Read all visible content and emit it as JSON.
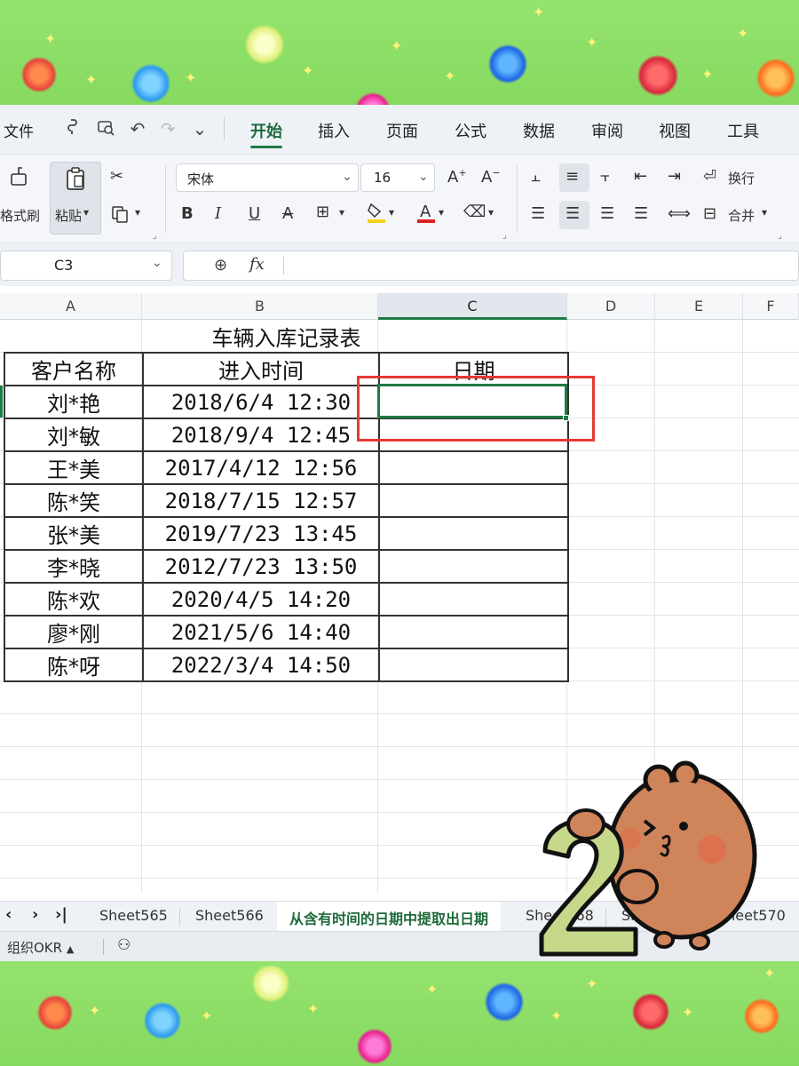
{
  "menubar": {
    "file": "文件",
    "tabs": [
      "开始",
      "插入",
      "页面",
      "公式",
      "数据",
      "审阅",
      "视图",
      "工具"
    ],
    "active_tab": "开始"
  },
  "ribbon": {
    "format_painter": "格式刷",
    "paste": "粘贴",
    "font_name": "宋体",
    "font_size": "16",
    "wrap_text": "换行",
    "merge": "合并"
  },
  "formula_bar": {
    "cell_ref": "C3",
    "fx_label": "fx",
    "content": ""
  },
  "columns": [
    "A",
    "B",
    "C",
    "D",
    "E",
    "F"
  ],
  "table": {
    "title": "车辆入库记录表",
    "headers": [
      "客户名称",
      "进入时间",
      "日期"
    ],
    "rows": [
      {
        "name": "刘*艳",
        "time": "2018/6/4 12:30",
        "date": ""
      },
      {
        "name": "刘*敏",
        "time": "2018/9/4 12:45",
        "date": ""
      },
      {
        "name": "王*美",
        "time": "2017/4/12 12:56",
        "date": ""
      },
      {
        "name": "陈*笑",
        "time": "2018/7/15 12:57",
        "date": ""
      },
      {
        "name": "张*美",
        "time": "2019/7/23 13:45",
        "date": ""
      },
      {
        "name": "李*晓",
        "time": "2012/7/23 13:50",
        "date": ""
      },
      {
        "name": "陈*欢",
        "time": "2020/4/5 14:20",
        "date": ""
      },
      {
        "name": "廖*刚",
        "time": "2021/5/6 14:40",
        "date": ""
      },
      {
        "name": "陈*呀",
        "time": "2022/3/4 14:50",
        "date": ""
      }
    ]
  },
  "sheet_tabs": [
    "Sheet565",
    "Sheet566",
    "从含有时间的日期中提取出日期",
    "Sheet568",
    "Sheet569",
    "Sheet570"
  ],
  "active_sheet": "从含有时间的日期中提取出日期",
  "status": {
    "okr": "组织OKR"
  },
  "mascot_number": "2",
  "colors": {
    "accent": "#1f7a45",
    "highlight": "#e53935",
    "background": "#8ee06a"
  }
}
